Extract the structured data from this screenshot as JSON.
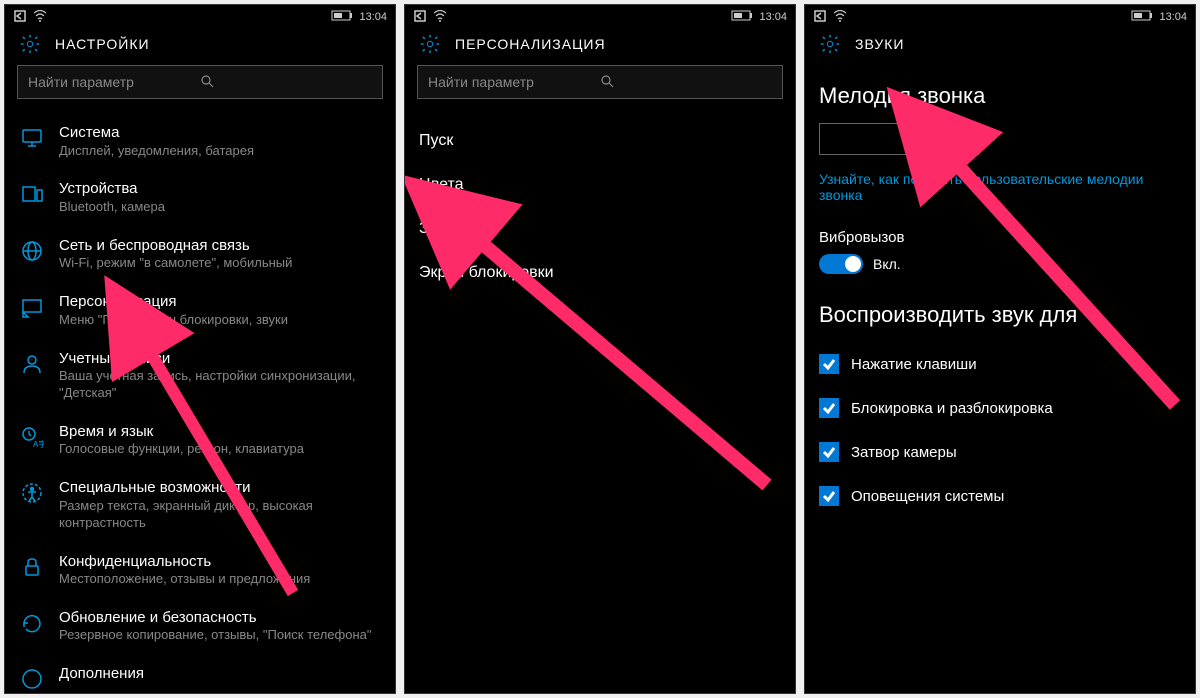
{
  "status": {
    "time": "13:04"
  },
  "screen1": {
    "title": "НАСТРОЙКИ",
    "search_placeholder": "Найти параметр",
    "items": [
      {
        "label": "Система",
        "sub": "Дисплей, уведомления, батарея"
      },
      {
        "label": "Устройства",
        "sub": "Bluetooth, камера"
      },
      {
        "label": "Сеть и беспроводная связь",
        "sub": "Wi-Fi, режим \"в самолете\", мобильный"
      },
      {
        "label": "Персонализация",
        "sub": "Меню \"Пуск\", экран блокировки, звуки"
      },
      {
        "label": "Учетные записи",
        "sub": "Ваша учетная запись, настройки синхронизации, \"Детская\""
      },
      {
        "label": "Время и язык",
        "sub": "Голосовые функции, регион, клавиатура"
      },
      {
        "label": "Специальные возможности",
        "sub": "Размер текста, экранный диктор, высокая контрастность"
      },
      {
        "label": "Конфиденциальность",
        "sub": "Местоположение, отзывы и предложения"
      },
      {
        "label": "Обновление и безопасность",
        "sub": "Резервное копирование, отзывы, \"Поиск телефона\""
      },
      {
        "label": "Дополнения",
        "sub": ""
      }
    ]
  },
  "screen2": {
    "title": "ПЕРСОНАЛИЗАЦИЯ",
    "search_placeholder": "Найти параметр",
    "items": [
      "Пуск",
      "Цвета",
      "Звуки",
      "Экран блокировки"
    ]
  },
  "screen3": {
    "title": "ЗВУКИ",
    "ringtone_label": "Мелодия звонка",
    "link": "Узнайте, как получить пользовательские мелодии звонка",
    "vibrate_label": "Вибровызов",
    "toggle_state": "Вкл.",
    "play_sound_for": "Воспроизводить звук для",
    "checks": [
      "Нажатие клавиши",
      "Блокировка и разблокировка",
      "Затвор камеры",
      "Оповещения системы"
    ]
  }
}
